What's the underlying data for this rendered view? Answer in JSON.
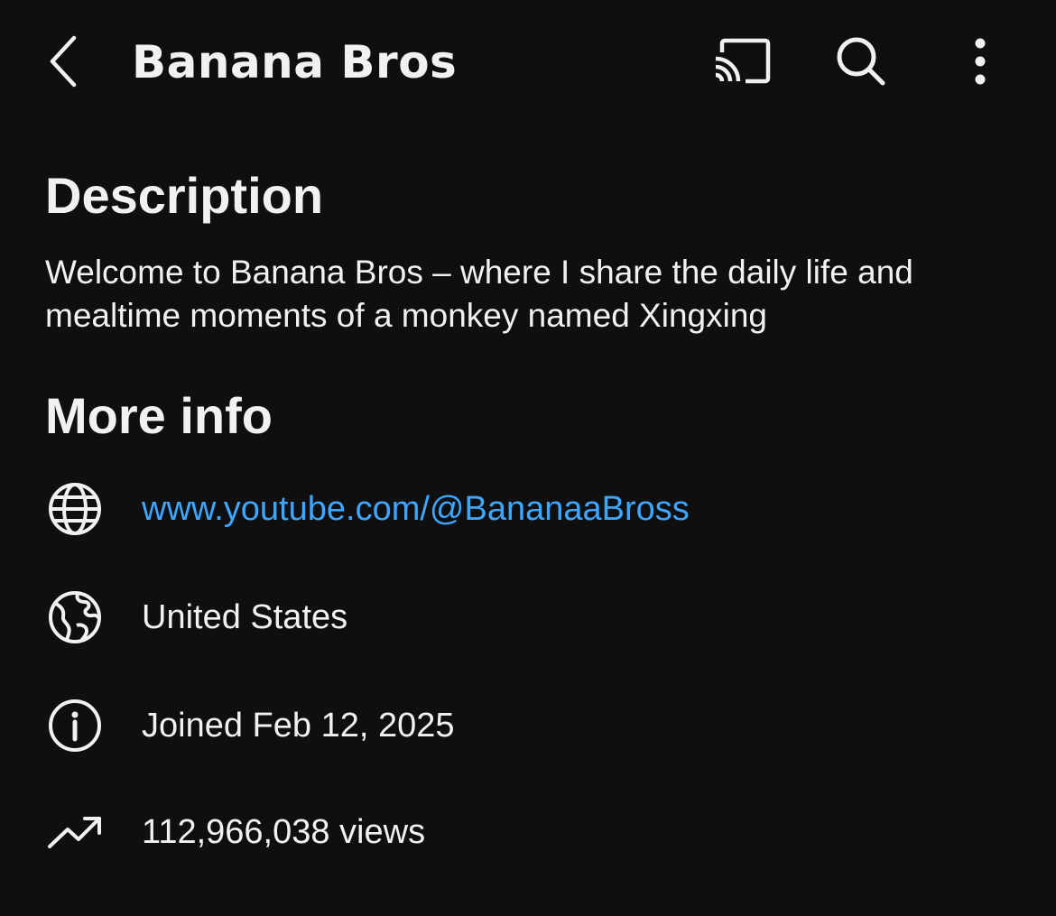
{
  "header": {
    "title": "Banana Bros",
    "back_icon": "chevron-left-icon",
    "cast_icon": "cast-icon",
    "search_icon": "search-icon",
    "more_icon": "more-vertical-icon"
  },
  "description": {
    "heading": "Description",
    "text": "Welcome to Banana Bros – where I share the daily life and mealtime moments of a monkey named Xingxing"
  },
  "more_info": {
    "heading": "More info",
    "link": {
      "icon": "globe-icon",
      "text": "www.youtube.com/@BananaaBross",
      "color": "#3ea6ff"
    },
    "country": {
      "icon": "earth-icon",
      "text": "United States"
    },
    "joined": {
      "icon": "info-icon",
      "text": "Joined Feb 12, 2025"
    },
    "views": {
      "icon": "trending-up-icon",
      "text": "112,966,038 views"
    }
  },
  "colors": {
    "background": "#0f0f0f",
    "text": "#f1f1f1",
    "link": "#3ea6ff"
  }
}
